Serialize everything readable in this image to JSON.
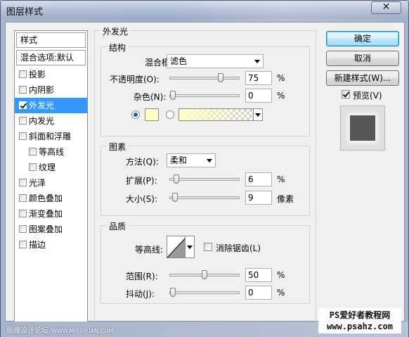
{
  "window": {
    "title": "图层样式",
    "close_label": "✕"
  },
  "style_list": {
    "header": "样式",
    "blend_options": "混合选项:默认",
    "items": [
      {
        "label": "投影",
        "checked": false
      },
      {
        "label": "内阴影",
        "checked": false
      },
      {
        "label": "外发光",
        "checked": true,
        "selected": true
      },
      {
        "label": "内发光",
        "checked": false
      },
      {
        "label": "斜面和浮雕",
        "checked": false
      },
      {
        "label": "等高线",
        "checked": false,
        "sub": true
      },
      {
        "label": "纹理",
        "checked": false,
        "sub": true
      },
      {
        "label": "光泽",
        "checked": false
      },
      {
        "label": "颜色叠加",
        "checked": false
      },
      {
        "label": "渐变叠加",
        "checked": false
      },
      {
        "label": "图案叠加",
        "checked": false
      },
      {
        "label": "描边",
        "checked": false
      }
    ]
  },
  "outer_glow": {
    "title": "外发光",
    "structure": {
      "title": "结构",
      "blend_mode_label": "混合模式:",
      "blend_mode_value": "滤色",
      "opacity_label": "不透明度(O):",
      "opacity_value": "75",
      "opacity_unit": "%",
      "opacity_fraction": 0.75,
      "noise_label": "杂色(N):",
      "noise_value": "0",
      "noise_unit": "%",
      "noise_fraction": 0,
      "color": "#ffffc4"
    },
    "elements": {
      "title": "图素",
      "method_label": "方法(Q):",
      "method_value": "柔和",
      "spread_label": "扩展(P):",
      "spread_value": "6",
      "spread_unit": "%",
      "spread_fraction": 0.06,
      "size_label": "大小(S):",
      "size_value": "9",
      "size_unit": "像素",
      "size_fraction": 0.036
    },
    "quality": {
      "title": "品质",
      "contour_label": "等高线:",
      "anti_alias_label": "消除锯齿(L)",
      "anti_alias_checked": false,
      "range_label": "范围(R):",
      "range_value": "50",
      "range_unit": "%",
      "range_fraction": 0.5,
      "jitter_label": "抖动(J):",
      "jitter_value": "0",
      "jitter_unit": "%",
      "jitter_fraction": 0
    }
  },
  "buttons": {
    "ok": "确定",
    "cancel": "取消",
    "new_style": "新建样式(W)...",
    "preview_label": "预览(V)",
    "preview_checked": true
  },
  "watermarks": {
    "left": "思缘设计论坛",
    "left_small": "WWW.MISSYUAN.COM",
    "right_line1": "PS爱好者教程网",
    "right_line2": "www.psahz.com"
  }
}
